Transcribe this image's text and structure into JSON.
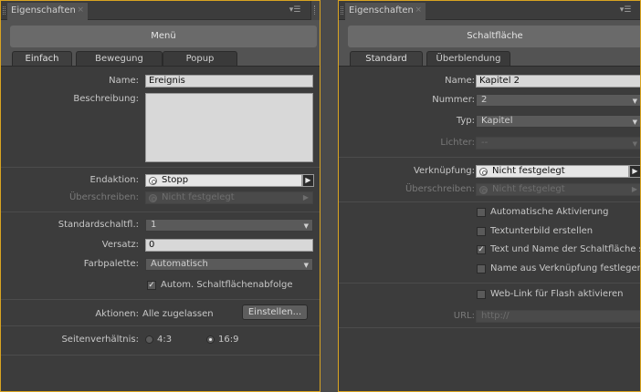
{
  "left_panel": {
    "tab_title": "Eigenschaften",
    "close_glyph": "×",
    "menu_glyph": "▾☰",
    "header": "Menü",
    "tabs": [
      "Einfach",
      "Bewegung",
      "Popup"
    ],
    "active_tab": "Einfach",
    "name_label": "Name:",
    "name_value": "Ereignis",
    "description_label": "Beschreibung:",
    "end_action_label": "Endaktion:",
    "end_action_value": "Stopp",
    "override_label": "Überschreiben:",
    "override_value": "Nicht festgelegt",
    "default_button_label": "Standardschaltfl.:",
    "default_button_value": "1",
    "offset_label": "Versatz:",
    "offset_value": "0",
    "palette_label": "Farbpalette:",
    "palette_value": "Automatisch",
    "auto_button_order_label": "Autom. Schaltflächenabfolge",
    "auto_button_order_checked": true,
    "actions_label": "Aktionen:",
    "actions_value": "Alle zugelassen",
    "settings_button": "Einstellen...",
    "aspect_label": "Seitenverhältnis:",
    "aspect_options": [
      "4:3",
      "16:9"
    ],
    "aspect_selected": "16:9"
  },
  "right_panel": {
    "tab_title": "Eigenschaften",
    "close_glyph": "×",
    "menu_glyph": "▾☰",
    "header": "Schaltfläche",
    "tabs": [
      "Standard",
      "Überblendung"
    ],
    "active_tab": "Standard",
    "name_label": "Name:",
    "name_value": "Kapitel 2",
    "number_label": "Nummer:",
    "number_value": "2",
    "type_label": "Typ:",
    "type_value": "Kapitel",
    "lights_label": "Lichter:",
    "lights_value": "--",
    "link_label": "Verknüpfung:",
    "link_value": "Nicht festgelegt",
    "override_label": "Überschreiben:",
    "override_value": "Nicht festgelegt",
    "checkboxes": [
      {
        "label": "Automatische Aktivierung",
        "checked": false
      },
      {
        "label": "Textunterbild erstellen",
        "checked": false
      },
      {
        "label": "Text und Name der Schaltfläche s...",
        "checked": true
      },
      {
        "label": "Name aus Verknüpfung festlegen",
        "checked": false
      }
    ],
    "weblink_label": "Web-Link für Flash aktivieren",
    "weblink_checked": false,
    "url_label": "URL:",
    "url_placeholder": "http://"
  },
  "colors": {
    "panel_border": "#d9a421",
    "panel_bg": "#535353",
    "content_bg": "#3c3c3c",
    "field_bg": "#d8d8d8"
  },
  "icons": {
    "target": "link-target-icon",
    "play": "play-icon",
    "dropdown": "chevron-down-icon",
    "check": "checkmark-icon",
    "panel_menu": "panel-menu-icon"
  }
}
